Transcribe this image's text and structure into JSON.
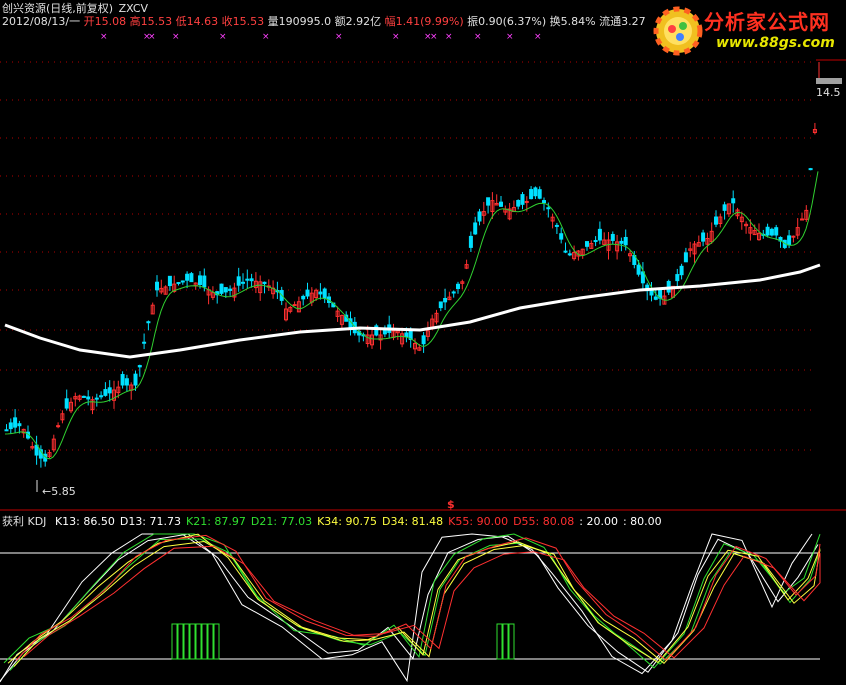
{
  "header": {
    "title": "创兴资源(日线,前复权)",
    "code": "ZXCV",
    "date": "2012/08/13/一",
    "open_label": "开",
    "open_value": "15.08",
    "high_label": "高",
    "high_value": "15.53",
    "low_label": "低",
    "low_value": "14.63",
    "close_label": "收",
    "close_value": "15.53",
    "volume_label": "量",
    "volume_value": "190995.0",
    "amount_label": "额",
    "amount_value": "2.92亿",
    "change_label": "幅",
    "change_value": "1.41(9.99%)",
    "amplitude_label": "振",
    "amplitude_value": "0.90(6.37%)",
    "turnover_label": "换",
    "turnover_value": "5.84%",
    "float_label": "流通",
    "float_value": "3.27"
  },
  "logo": {
    "title": "分析家公式网",
    "url": "www.88gs.com"
  },
  "main_chart": {
    "price_tag": "14.5",
    "min_label": "←5.85",
    "colors": {
      "up": "#ff3030",
      "down": "#00e0ff",
      "ma_short": "#30d030",
      "ma_long": "#ffffff"
    }
  },
  "indicator": {
    "name": "获利 KDJ",
    "signal_mark": "$",
    "params": [
      {
        "label": "K13:",
        "value": "86.50",
        "color": "#ffffff"
      },
      {
        "label": "D13:",
        "value": "71.73",
        "color": "#ffffff"
      },
      {
        "label": "K21:",
        "value": "87.97",
        "color": "#30e030"
      },
      {
        "label": "D21:",
        "value": "77.03",
        "color": "#30e030"
      },
      {
        "label": "K34:",
        "value": "90.75",
        "color": "#ffff40"
      },
      {
        "label": "D34:",
        "value": "81.48",
        "color": "#ffff40"
      },
      {
        "label": "K55:",
        "value": "90.00",
        "color": "#ff3030"
      },
      {
        "label": "D55:",
        "value": "80.08",
        "color": "#ff3030"
      },
      {
        "label": ":",
        "value": "20.00",
        "color": "#ffffff"
      },
      {
        "label": ":",
        "value": "80.00",
        "color": "#ffffff"
      }
    ]
  }
}
